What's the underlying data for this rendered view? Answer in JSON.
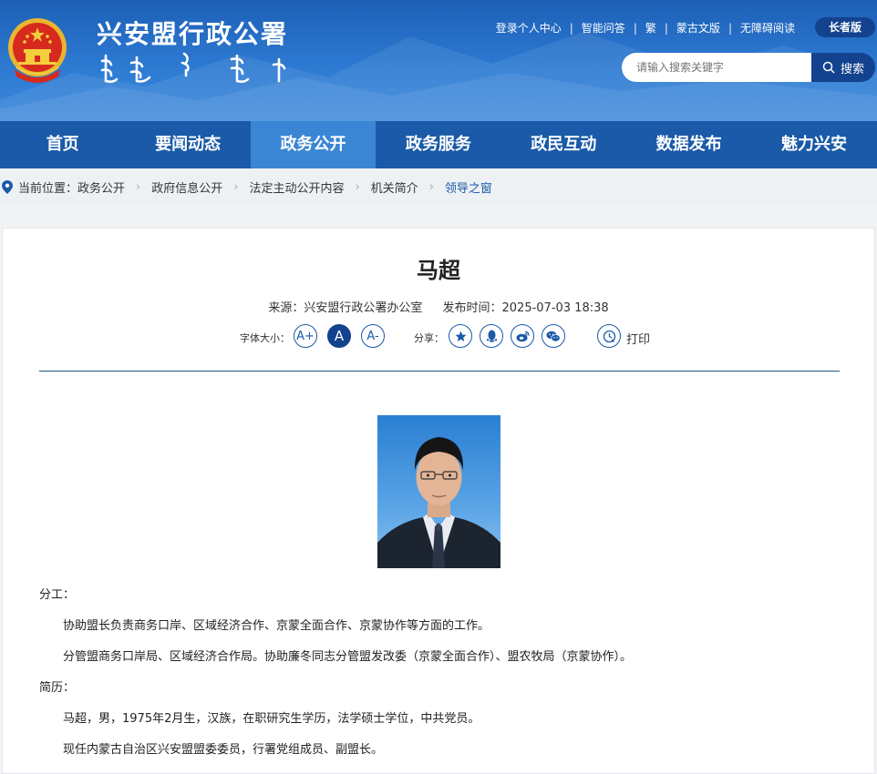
{
  "header": {
    "site_title": "兴安盟行政公署",
    "top_links": [
      "登录个人中心",
      "智能问答",
      "繁",
      "蒙古文版",
      "无障碍阅读"
    ],
    "elder_mode": "长者版",
    "search_placeholder": "请输入搜索关键字",
    "search_button": "搜索"
  },
  "nav": {
    "items": [
      "首页",
      "要闻动态",
      "政务公开",
      "政务服务",
      "政民互动",
      "数据发布",
      "魅力兴安"
    ],
    "active": "政务公开"
  },
  "breadcrumb": {
    "label": "当前位置：",
    "items": [
      "政务公开",
      "政府信息公开",
      "法定主动公开内容",
      "机关简介",
      "领导之窗"
    ]
  },
  "article": {
    "title": "马超",
    "source": "来源：兴安盟行政公署办公室",
    "published": "发布时间：2025-07-03 18:38",
    "font_size_label": "字体大小：",
    "font_buttons": [
      "A+",
      "A",
      "A-"
    ],
    "share_label": "分享：",
    "print_label": "打印",
    "section_duty": "分工：",
    "duty_lines": [
      "协助盟长负责商务口岸、区域经济合作、京蒙全面合作、京蒙协作等方面的工作。",
      "分管盟商务口岸局、区域经济合作局。协助廉冬同志分管盟发改委（京蒙全面合作）、盟农牧局（京蒙协作）。"
    ],
    "section_resume": "简历：",
    "resume_lines": [
      "马超，男，1975年2月生，汉族，在职研究生学历，法学硕士学位，中共党员。",
      "现任内蒙古自治区兴安盟盟委委员，行署党组成员、副盟长。"
    ]
  },
  "colors": {
    "brand_blue": "#1a5aa8",
    "dark_blue": "#13428e",
    "nav_active": "#3a86d4"
  }
}
